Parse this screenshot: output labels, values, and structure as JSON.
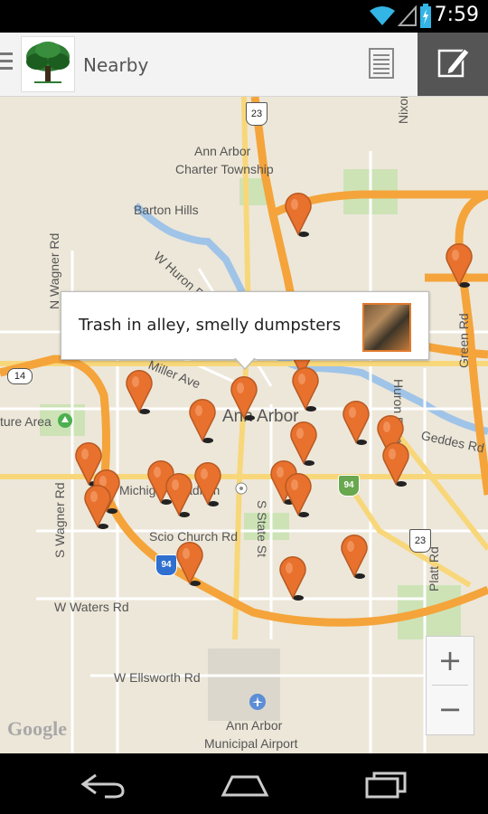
{
  "status_bar": {
    "time": "7:59",
    "icons": [
      "wifi-icon",
      "signal-icon",
      "battery-charging-icon"
    ]
  },
  "app_bar": {
    "title": "Nearby",
    "menu_icon": "hamburger-icon",
    "logo": "tree-logo",
    "list_icon": "list-view-icon",
    "edit_icon": "edit-icon"
  },
  "map": {
    "callout": {
      "text": "Trash in alley, smelly dumpsters",
      "thumbnail": "report-photo-thumbnail"
    },
    "labels": {
      "ann_arbor_charter": "Ann Arbor",
      "charter_township": "Charter Township",
      "barton_hills": "Barton Hills",
      "w_huron_river": "W Huron River",
      "miller_ave": "Miller Ave",
      "ann_arbor": "Ann Arbor",
      "nature_area": "ture Area",
      "n_wagner_rd": "N Wagner Rd",
      "s_wagner_rd": "S Wagner Rd",
      "michigan_stadium": "Michigan Stadium",
      "scio_church_rd": "Scio Church Rd",
      "s_state_st": "S State St",
      "w_waters_rd": "W Waters Rd",
      "w_ellsworth_rd": "W Ellsworth Rd",
      "airport_line1": "Ann Arbor",
      "airport_line2": "Municipal Airport",
      "nixon_rd": "Nixon Rd",
      "green_rd": "Green Rd",
      "geddes_rd": "Geddes Rd",
      "platt_rd": "Platt Rd",
      "huron_pkwy": "Huron Pkwy",
      "shield_23_top": "23",
      "shield_23_right": "23",
      "shield_14": "14",
      "shield_94_left": "94",
      "shield_94_right": "94",
      "google": "Google"
    },
    "zoom_in": "+",
    "zoom_out": "−",
    "pin_color": "#e8712e"
  },
  "nav_bar": {
    "back_icon": "back-icon",
    "home_icon": "home-icon",
    "recents_icon": "recent-apps-icon"
  }
}
